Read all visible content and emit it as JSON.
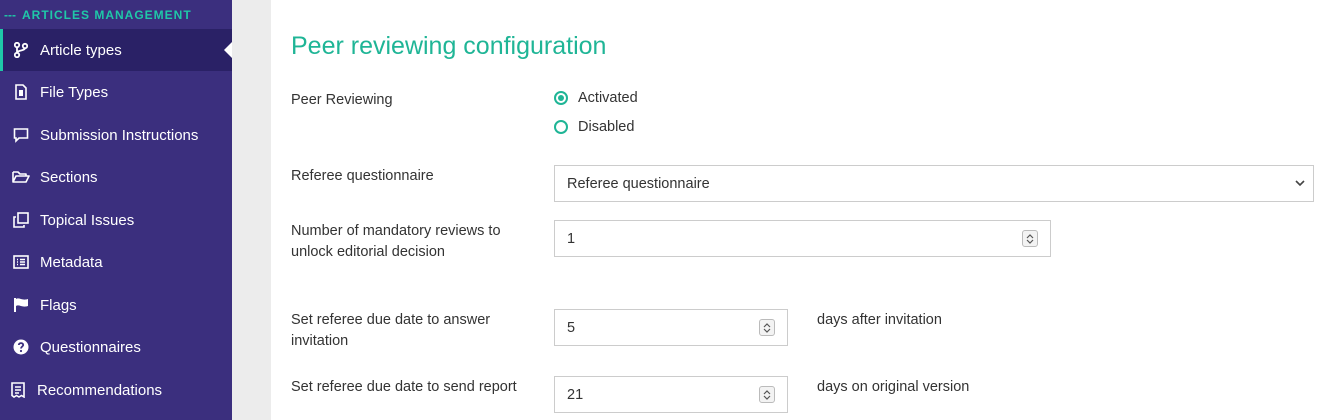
{
  "sidebar": {
    "section_title": "ARTICLES MANAGEMENT",
    "items": [
      {
        "label": "Article types",
        "icon": "branch-icon"
      },
      {
        "label": "File Types",
        "icon": "file-icon"
      },
      {
        "label": "Submission Instructions",
        "icon": "comment-icon"
      },
      {
        "label": "Sections",
        "icon": "folder-open-icon"
      },
      {
        "label": "Topical Issues",
        "icon": "clone-icon"
      },
      {
        "label": "Metadata",
        "icon": "list-alt-icon"
      },
      {
        "label": "Flags",
        "icon": "flag-icon"
      },
      {
        "label": "Questionnaires",
        "icon": "question-circle-icon"
      },
      {
        "label": "Recommendations",
        "icon": "receipt-icon"
      }
    ],
    "active_index": 0
  },
  "main": {
    "title": "Peer reviewing configuration",
    "peer_reviewing": {
      "label": "Peer Reviewing",
      "options": [
        "Activated",
        "Disabled"
      ],
      "selected": "Activated"
    },
    "referee_questionnaire": {
      "label": "Referee questionnaire",
      "value": "Referee questionnaire"
    },
    "mandatory_reviews": {
      "label_line1": "Number of mandatory reviews to",
      "label_line2": "unlock editorial decision",
      "value": "1"
    },
    "answer_invitation": {
      "label_line1": "Set referee due date to answer",
      "label_line2": "invitation",
      "value": "5",
      "suffix": "days after invitation"
    },
    "send_report": {
      "label": "Set referee due date to send report",
      "value": "21",
      "suffix": "days on original version"
    }
  },
  "colors": {
    "sidebar_bg": "#3b2f7e",
    "accent": "#1fb596",
    "active_bg": "#2a2166"
  }
}
